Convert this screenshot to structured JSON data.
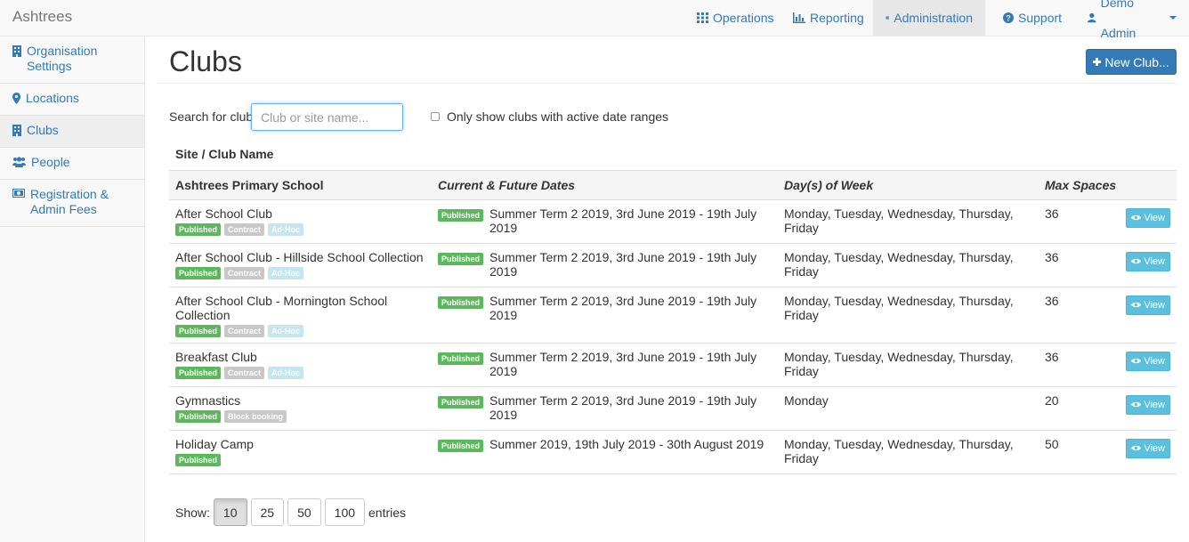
{
  "app": {
    "brand": "Ashtrees"
  },
  "topnav": {
    "operations": "Operations",
    "reporting": "Reporting",
    "administration": "Administration",
    "support": "Support",
    "user": "Demo Admin"
  },
  "sidebar": {
    "items": [
      {
        "label": "Organisation Settings"
      },
      {
        "label": "Locations"
      },
      {
        "label": "Clubs"
      },
      {
        "label": "People"
      },
      {
        "label": "Registration & Admin Fees"
      }
    ]
  },
  "page": {
    "title": "Clubs",
    "new_button": "New Club...",
    "search_label": "Search for club:",
    "search_placeholder": "Club or site name...",
    "search_value": "",
    "active_only_label": "Only show clubs with active date ranges",
    "active_only_checked": false
  },
  "table": {
    "header": "Site / Club Name",
    "group": {
      "site": "Ashtrees Primary School",
      "col_dates": "Current & Future Dates",
      "col_days": "Day(s) of Week",
      "col_spaces": "Max Spaces"
    },
    "view_label": "View",
    "rows": [
      {
        "name": "After School Club",
        "tags": [
          "Published",
          "Contract",
          "Ad-Hoc"
        ],
        "status": "Published",
        "dates": "Summer Term 2 2019, 3rd June 2019 - 19th July 2019",
        "days": "Monday, Tuesday, Wednesday, Thursday, Friday",
        "spaces": "36"
      },
      {
        "name": "After School Club - Hillside School Collection",
        "tags": [
          "Published",
          "Contract",
          "Ad-Hoc"
        ],
        "status": "Published",
        "dates": "Summer Term 2 2019, 3rd June 2019 - 19th July 2019",
        "days": "Monday, Tuesday, Wednesday, Thursday, Friday",
        "spaces": "36"
      },
      {
        "name": "After School Club - Mornington School Collection",
        "tags": [
          "Published",
          "Contract",
          "Ad-Hoc"
        ],
        "status": "Published",
        "dates": "Summer Term 2 2019, 3rd June 2019 - 19th July 2019",
        "days": "Monday, Tuesday, Wednesday, Thursday, Friday",
        "spaces": "36"
      },
      {
        "name": "Breakfast Club",
        "tags": [
          "Published",
          "Contract",
          "Ad-Hoc"
        ],
        "status": "Published",
        "dates": "Summer Term 2 2019, 3rd June 2019 - 19th July 2019",
        "days": "Monday, Tuesday, Wednesday, Thursday, Friday",
        "spaces": "36"
      },
      {
        "name": "Gymnastics",
        "tags": [
          "Published",
          "Block booking"
        ],
        "status": "Published",
        "dates": "Summer Term 2 2019, 3rd June 2019 - 19th July 2019",
        "days": "Monday",
        "spaces": "20"
      },
      {
        "name": "Holiday Camp",
        "tags": [
          "Published"
        ],
        "status": "Published",
        "dates": "Summer 2019, 19th July 2019 - 30th August 2019",
        "days": "Monday, Tuesday, Wednesday, Thursday, Friday",
        "spaces": "50"
      }
    ]
  },
  "pager": {
    "show_label": "Show:",
    "options": [
      "10",
      "25",
      "50",
      "100"
    ],
    "selected": "10",
    "entries_label": "entries"
  },
  "colors": {
    "link": "#337ab7",
    "published": "#5cb85c",
    "contract": "#c8c8c8",
    "adhoc": "#c5e5f0",
    "view": "#5bc0de"
  }
}
